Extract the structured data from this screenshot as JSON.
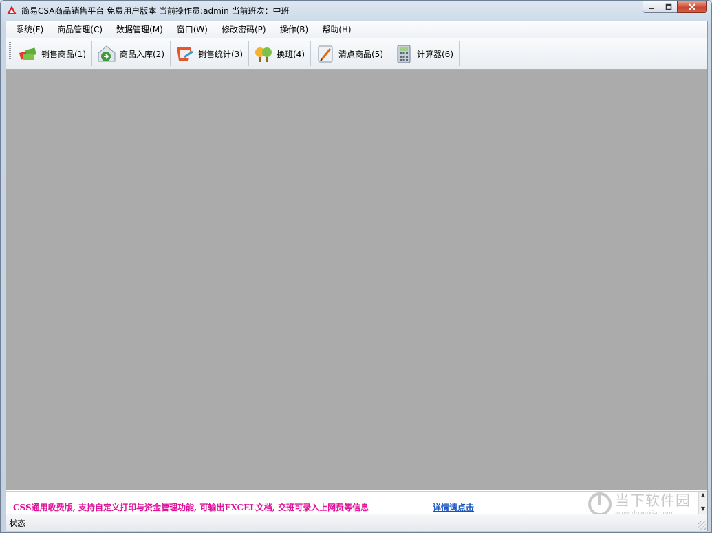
{
  "window": {
    "title": "简易CSA商品销售平台 免费用户版本 当前操作员:admin 当前班次：中班"
  },
  "menu": [
    {
      "label": "系统(F)"
    },
    {
      "label": "商品管理(C)"
    },
    {
      "label": "数据管理(M)"
    },
    {
      "label": "窗口(W)"
    },
    {
      "label": "修改密码(P)"
    },
    {
      "label": "操作(B)"
    },
    {
      "label": "帮助(H)"
    }
  ],
  "toolbar": [
    {
      "label": "销售商品(1)",
      "icon": "sell-goods-icon"
    },
    {
      "label": "商品入库(2)",
      "icon": "goods-inbound-icon"
    },
    {
      "label": "销售统计(3)",
      "icon": "sales-statistics-icon"
    },
    {
      "label": "换班(4)",
      "icon": "shift-change-icon"
    },
    {
      "label": "清点商品(5)",
      "icon": "inventory-check-icon"
    },
    {
      "label": "计算器(6)",
      "icon": "calculator-icon"
    }
  ],
  "ad": {
    "text": "CSS通用收费版, 支持自定义打印与资金管理功能, 可输出EXCEL文档, 交班可录入上网费等信息",
    "link": "详情请点击"
  },
  "watermark": {
    "title": "当下软件园",
    "url": "www.downxia.com"
  },
  "status": {
    "label": "状态"
  },
  "colors": {
    "mdi_background": "#ababab",
    "ad_text": "#e0129a",
    "ad_link": "#1652c0"
  }
}
